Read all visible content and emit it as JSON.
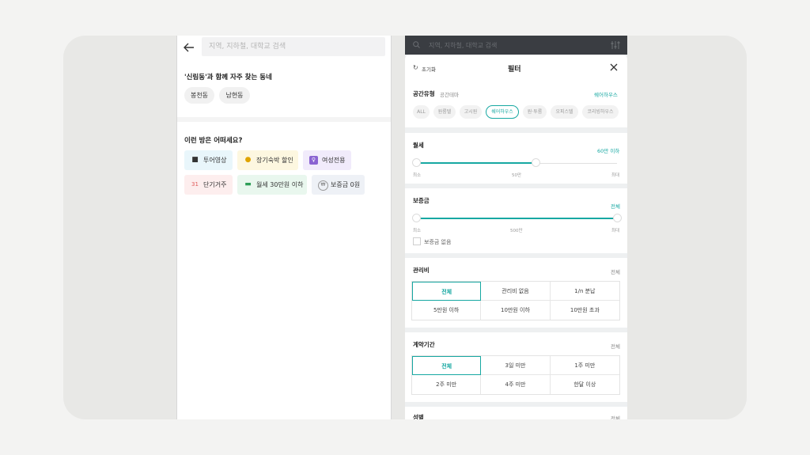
{
  "left": {
    "search_placeholder": "지역, 지하철, 대학교 검색",
    "section1_title": "'신림동'과 함께 자주 찾는 동네",
    "nearby": [
      "봉천동",
      "남현동"
    ],
    "section2_title": "이런 방은 어떠세요?",
    "recommend": [
      {
        "label": "투어영상",
        "icon": "video-icon",
        "bg": "#e9f6fb"
      },
      {
        "label": "장기숙박 할인",
        "icon": "money-bag-icon",
        "bg": "#fdf7e0"
      },
      {
        "label": "여성전용",
        "icon": "female-icon",
        "bg": "#f1ebfb"
      },
      {
        "label": "단기거주",
        "icon": "calendar-icon",
        "bg": "#fdeeee"
      },
      {
        "label": "월세 30만원 이하",
        "icon": "cash-icon",
        "bg": "#e9f7ee"
      },
      {
        "label": "보증금 0원",
        "icon": "won-icon",
        "bg": "#eef1f6"
      }
    ]
  },
  "right": {
    "top_placeholder": "지역, 지하철, 대학교 검색",
    "reset_label": "초기화",
    "title": "필터",
    "space": {
      "label": "공간유형",
      "tab2": "공간테마",
      "value": "쉐어하우스",
      "types": [
        {
          "label": "ALL",
          "selected": false
        },
        {
          "label": "원룸텔",
          "selected": false
        },
        {
          "label": "고시원",
          "selected": false
        },
        {
          "label": "쉐어하우스",
          "selected": true
        },
        {
          "label": "원·투룸",
          "selected": false
        },
        {
          "label": "오피스텔",
          "selected": false
        },
        {
          "label": "코리빙하우스",
          "selected": false
        }
      ]
    },
    "rent": {
      "label": "월세",
      "value": "60만 이하",
      "min": "최소",
      "mid": "50만",
      "max": "최대",
      "fraction": 0.6
    },
    "deposit": {
      "label": "보증금",
      "value": "전체",
      "min": "최소",
      "mid": "500만",
      "max": "최대",
      "none_label": "보증금 없음"
    },
    "mgmt": {
      "label": "관리비",
      "value": "전체",
      "options": [
        "전체",
        "관리비 없음",
        "1/n 분납",
        "5만원 이하",
        "10만원 이하",
        "10만원 초과"
      ]
    },
    "contract": {
      "label": "계약기간",
      "value": "전체",
      "options": [
        "전체",
        "3일 미만",
        "1주 미만",
        "2주 미만",
        "4주 미만",
        "한달 이상"
      ]
    },
    "gender": {
      "label": "성별",
      "value": "전체"
    },
    "accent": "#17a8a2"
  }
}
